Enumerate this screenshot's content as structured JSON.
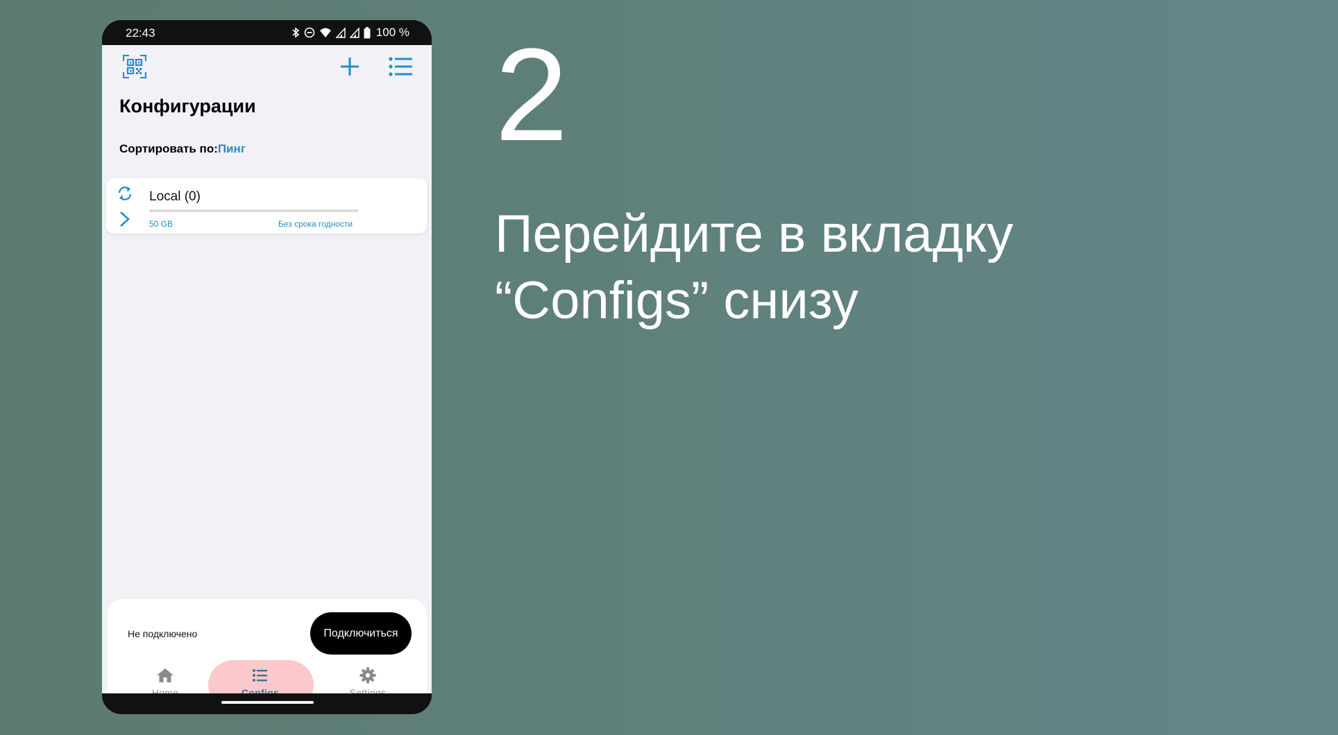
{
  "status_bar": {
    "time": "22:43",
    "battery": "100 %"
  },
  "screen": {
    "title": "Конфигурации",
    "sort": {
      "label": "Сортировать по:",
      "value": "Пинг"
    },
    "profile": {
      "name": "Local (0)",
      "traffic": "50 GB",
      "expiry": "Без срока годности",
      "usage_fraction": 0
    },
    "connection": {
      "status": "Не подключено",
      "button": "Подключиться"
    },
    "nav": {
      "home": "Home",
      "configs": "Configs",
      "settings": "Settings",
      "active": "configs"
    }
  },
  "instruction": {
    "step": "2",
    "line1": "Перейдите в вкладку",
    "line2": "“Configs” снизу"
  },
  "colors": {
    "accent": "#1f8fc9",
    "nav_active_pill": "#fbc9cb",
    "background": "#5f807a"
  }
}
